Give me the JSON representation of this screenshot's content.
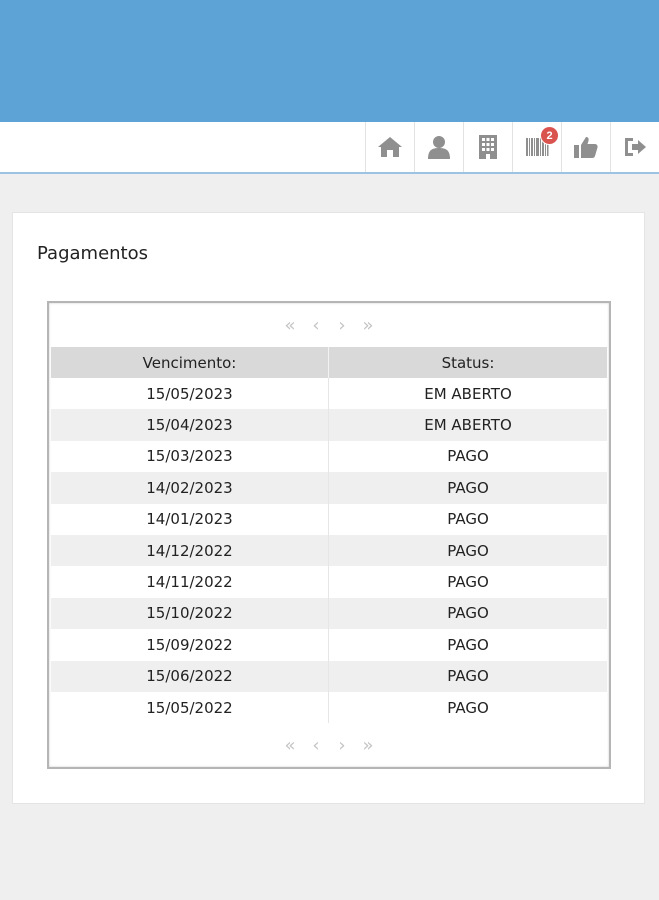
{
  "toolbar": {
    "notification_count": "2",
    "buttons": [
      "home-icon",
      "user-icon",
      "building-icon",
      "barcode-icon",
      "thumbs-up-icon",
      "logout-icon"
    ]
  },
  "panel": {
    "title": "Pagamentos"
  },
  "pager": {
    "first": "«",
    "prev": "‹",
    "next": "›",
    "last": "»"
  },
  "table": {
    "headers": [
      "Vencimento:",
      "Status:"
    ],
    "rows": [
      [
        "15/05/2023",
        "EM ABERTO"
      ],
      [
        "15/04/2023",
        "EM ABERTO"
      ],
      [
        "15/03/2023",
        "PAGO"
      ],
      [
        "14/02/2023",
        "PAGO"
      ],
      [
        "14/01/2023",
        "PAGO"
      ],
      [
        "14/12/2022",
        "PAGO"
      ],
      [
        "14/11/2022",
        "PAGO"
      ],
      [
        "15/10/2022",
        "PAGO"
      ],
      [
        "15/09/2022",
        "PAGO"
      ],
      [
        "15/06/2022",
        "PAGO"
      ],
      [
        "15/05/2022",
        "PAGO"
      ]
    ]
  },
  "colors": {
    "banner": "#5ea3d6",
    "badge": "#d9534f",
    "icon": "#8f8f8f"
  }
}
